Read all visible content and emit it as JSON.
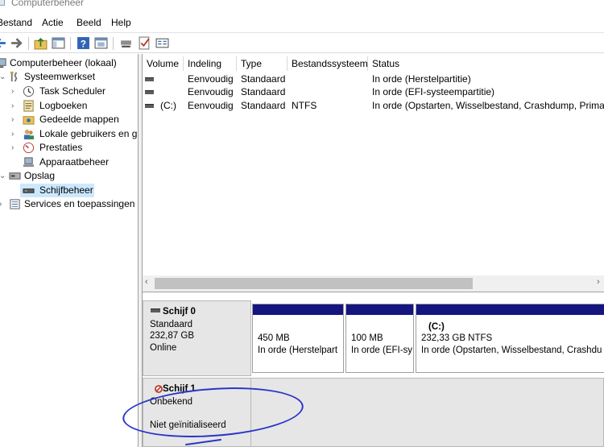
{
  "window": {
    "title": "Computerbeheer"
  },
  "menu": [
    "Bestand",
    "Actie",
    "Beeld",
    "Help"
  ],
  "toolbar": {
    "icons": [
      "back-arrow-icon",
      "forward-arrow-icon",
      "up-folder-icon",
      "show-tree-icon",
      "help-icon",
      "properties-icon",
      "connect-icon",
      "check-icon",
      "settings-icon"
    ]
  },
  "tree": {
    "root": "Computerbeheer (lokaal)",
    "systeemwerkset": "Systeemwerkset",
    "task_scheduler": "Task Scheduler",
    "logboeken": "Logboeken",
    "gedeelde_mappen": "Gedeelde mappen",
    "lokale_gebruikers": "Lokale gebruikers en gr",
    "prestaties": "Prestaties",
    "apparaatbeheer": "Apparaatbeheer",
    "opslag": "Opslag",
    "schijfbeheer": "Schijfbeheer",
    "services": "Services en toepassingen"
  },
  "columns": [
    "Volume",
    "Indeling",
    "Type",
    "Bestandssysteem",
    "Status"
  ],
  "volumes": [
    {
      "volume": "",
      "indeling": "Eenvoudig",
      "type": "Standaard",
      "fs": "",
      "status": "In orde (Herstelpartitie)"
    },
    {
      "volume": "",
      "indeling": "Eenvoudig",
      "type": "Standaard",
      "fs": "",
      "status": "In orde (EFI-systeempartitie)"
    },
    {
      "volume": "(C:)",
      "indeling": "Eenvoudig",
      "type": "Standaard",
      "fs": "NTFS",
      "status": "In orde (Opstarten, Wisselbestand, Crashdump, Primaire"
    }
  ],
  "disk0": {
    "name": "Schijf 0",
    "type": "Standaard",
    "size": "232,87 GB",
    "state": "Online",
    "partitions": [
      {
        "title": "",
        "size": "450 MB",
        "status": "In orde (Herstelpart"
      },
      {
        "title": "",
        "size": "100 MB",
        "status": "In orde (EFI-sy"
      },
      {
        "title": "(C:)",
        "size": "232,33 GB NTFS",
        "status": "In orde (Opstarten, Wisselbestand, Crashdu"
      }
    ]
  },
  "disk1": {
    "name": "Schijf 1",
    "type": "Onbekend",
    "state": "Niet geïnitialiseerd"
  },
  "colors": {
    "partition_bar": "#15157f",
    "selection": "#cce8ff",
    "annotation": "#2a35c8"
  }
}
